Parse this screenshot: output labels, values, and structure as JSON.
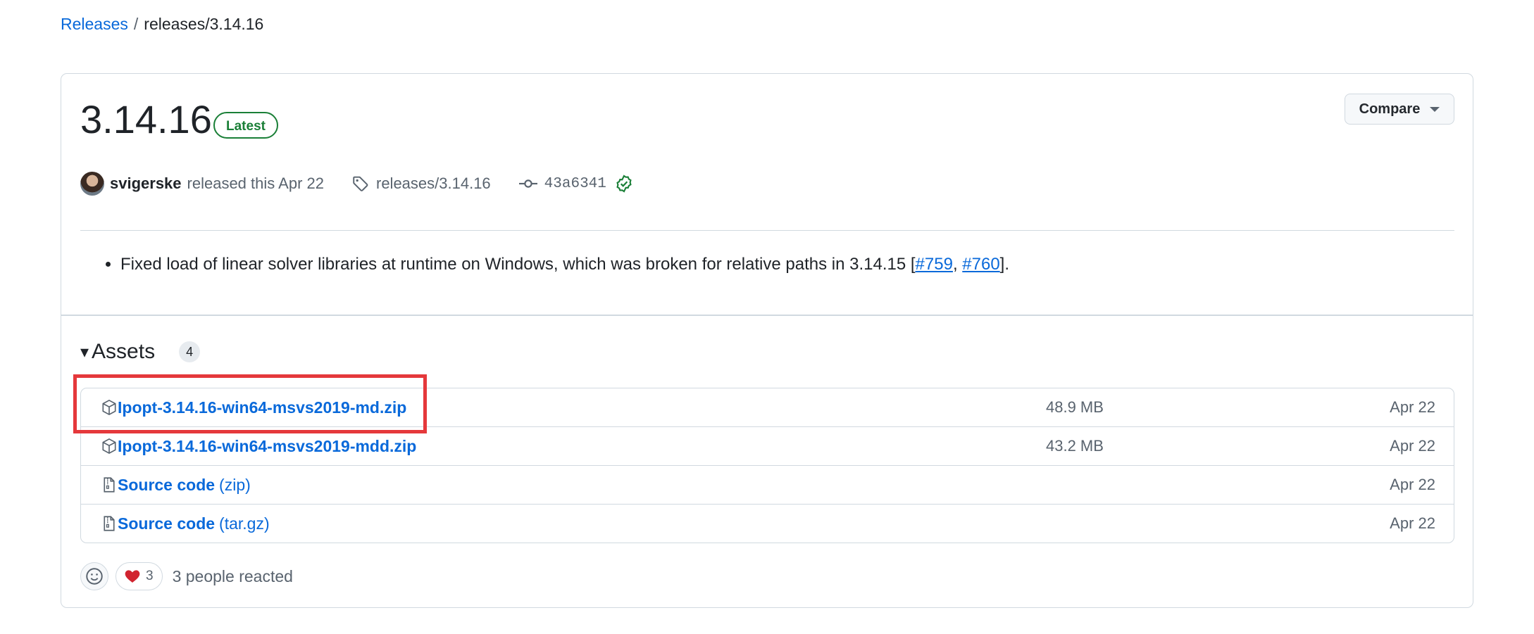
{
  "breadcrumb": {
    "parent": "Releases",
    "separator": "/",
    "current": "releases/3.14.16"
  },
  "release": {
    "title": "3.14.16",
    "badge": "Latest",
    "compare_label": "Compare",
    "author": "svigerske",
    "released_text": "released this Apr 22",
    "tag": "releases/3.14.16",
    "commit_sha": "43a6341"
  },
  "notes": {
    "item_text": "Fixed load of linear solver libraries at runtime on Windows, which was broken for relative paths in 3.14.15 [",
    "link1": "#759",
    "comma": ", ",
    "link2": "#760",
    "end": "]."
  },
  "assets": {
    "title": "Assets",
    "count": "4",
    "items": [
      {
        "name": "Ipopt-3.14.16-win64-msvs2019-md.zip",
        "paren": "",
        "size": "48.9 MB",
        "date": "Apr 22",
        "icon": "package-icon"
      },
      {
        "name": "Ipopt-3.14.16-win64-msvs2019-mdd.zip",
        "paren": "",
        "size": "43.2 MB",
        "date": "Apr 22",
        "icon": "package-icon"
      },
      {
        "name": "Source code",
        "paren": "(zip)",
        "size": "",
        "date": "Apr 22",
        "icon": "file-zip-icon"
      },
      {
        "name": "Source code",
        "paren": "(tar.gz)",
        "size": "",
        "date": "Apr 22",
        "icon": "file-zip-icon"
      }
    ]
  },
  "reactions": {
    "heart_count": "3",
    "summary": "3 people reacted"
  },
  "colors": {
    "link": "#0969da",
    "latest": "#1a7f37",
    "highlight": "#e5383b",
    "heart": "#d1242f"
  }
}
